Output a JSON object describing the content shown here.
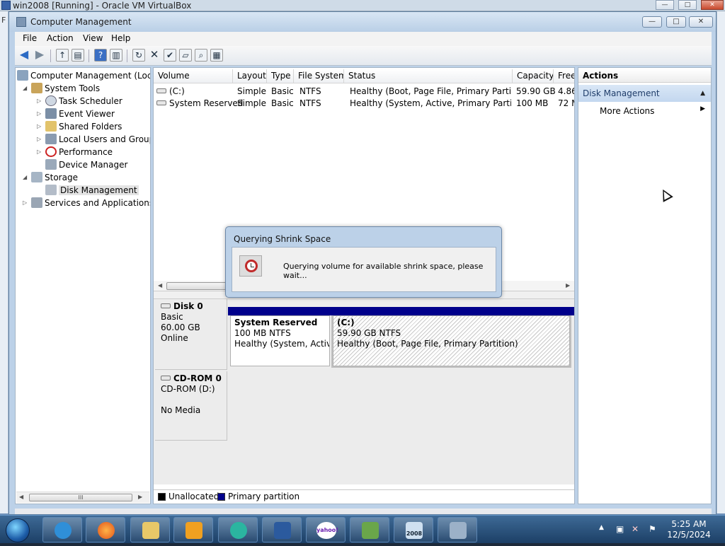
{
  "host": {
    "title": "win2008 [Running] - Oracle VM VirtualBox",
    "menu_stub": "F"
  },
  "window": {
    "title": "Computer Management"
  },
  "menu": [
    "File",
    "Action",
    "View",
    "Help"
  ],
  "tree": {
    "root": "Computer Management (Local",
    "system_tools": "System Tools",
    "task_scheduler": "Task Scheduler",
    "event_viewer": "Event Viewer",
    "shared_folders": "Shared Folders",
    "local_users": "Local Users and Groups",
    "performance": "Performance",
    "device_manager": "Device Manager",
    "storage": "Storage",
    "disk_management": "Disk Management",
    "services": "Services and Applications",
    "scroll_thumb": "III"
  },
  "volumes": {
    "headers": [
      "Volume",
      "Layout",
      "Type",
      "File System",
      "Status",
      "Capacity",
      "Free"
    ],
    "rows": [
      {
        "volume": "(C:)",
        "layout": "Simple",
        "type": "Basic",
        "fs": "NTFS",
        "status": "Healthy (Boot, Page File, Primary Partition)",
        "capacity": "59.90 GB",
        "free": "4.86"
      },
      {
        "volume": "System Reserved",
        "layout": "Simple",
        "type": "Basic",
        "fs": "NTFS",
        "status": "Healthy (System, Active, Primary Partition)",
        "capacity": "100 MB",
        "free": "72 M"
      }
    ]
  },
  "disks": {
    "disk0": {
      "name": "Disk 0",
      "type": "Basic",
      "size": "60.00 GB",
      "state": "Online"
    },
    "partitions": [
      {
        "name": "System Reserved",
        "size": "100 MB NTFS",
        "status": "Healthy (System, Active,"
      },
      {
        "name": "(C:)",
        "size": "59.90 GB NTFS",
        "status": "Healthy (Boot, Page File, Primary Partition)"
      }
    ],
    "cdrom": {
      "name": "CD-ROM 0",
      "drive": "CD-ROM (D:)",
      "media": "No Media"
    }
  },
  "legend": {
    "unallocated": "Unallocated",
    "primary": "Primary partition"
  },
  "actions": {
    "heading": "Actions",
    "group": "Disk Management",
    "more": "More Actions"
  },
  "dialog": {
    "title": "Querying Shrink Space",
    "message": "Querying volume for available shrink space, please wait..."
  },
  "taskbar": {
    "time": "5:25 AM",
    "date": "12/5/2024",
    "yahoo": "yahoo!",
    "server_badge": "2008"
  },
  "colors": {
    "primary_partition": "#00008b",
    "unallocated": "#000000",
    "taskbar": "#1c3f66"
  }
}
